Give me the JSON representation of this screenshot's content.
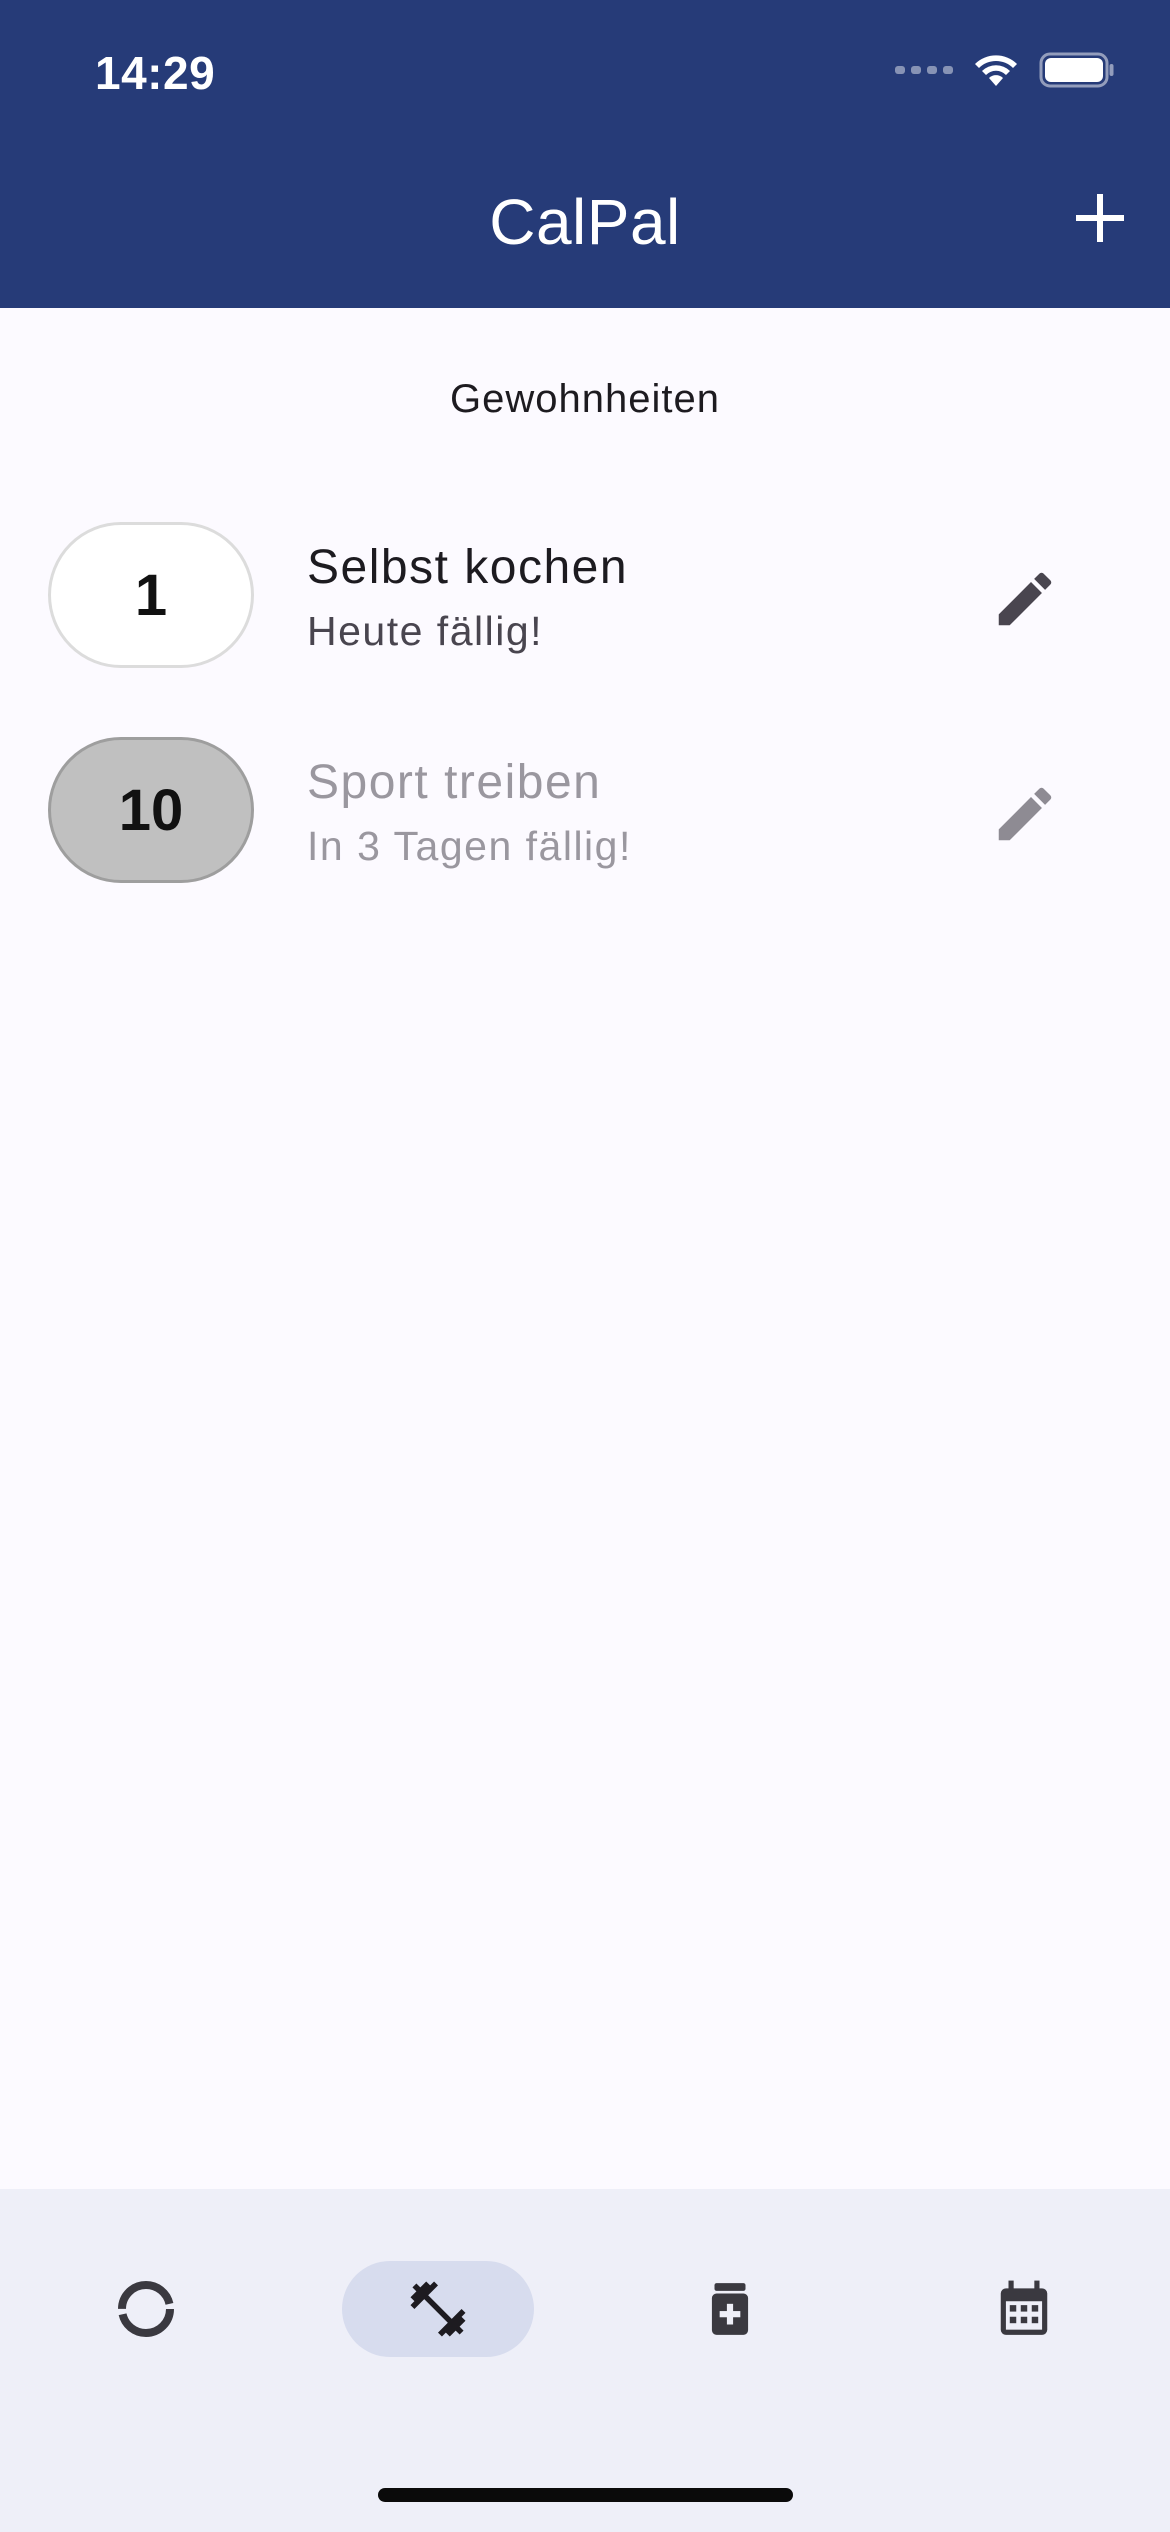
{
  "status_bar": {
    "time": "14:29"
  },
  "app_bar": {
    "title": "CalPal"
  },
  "section": {
    "title": "Gewohnheiten"
  },
  "habits": [
    {
      "count": "1",
      "name": "Selbst kochen",
      "due": "Heute fällig!",
      "state": "due"
    },
    {
      "count": "10",
      "name": "Sport treiben",
      "due": "In 3 Tagen fällig!",
      "state": "done"
    }
  ],
  "bottom_nav": {
    "items": [
      {
        "icon": "progress-ring-icon",
        "active": false
      },
      {
        "icon": "fitness-dumbbell-icon",
        "active": true
      },
      {
        "icon": "medication-icon",
        "active": false
      },
      {
        "icon": "calendar-icon",
        "active": false
      }
    ]
  },
  "colors": {
    "app_bar": "#263b78",
    "background": "#fcfaff",
    "nav_background": "#eeeff8",
    "nav_active_indicator": "#d7dcee",
    "done_pill": "#c0c0c0"
  }
}
